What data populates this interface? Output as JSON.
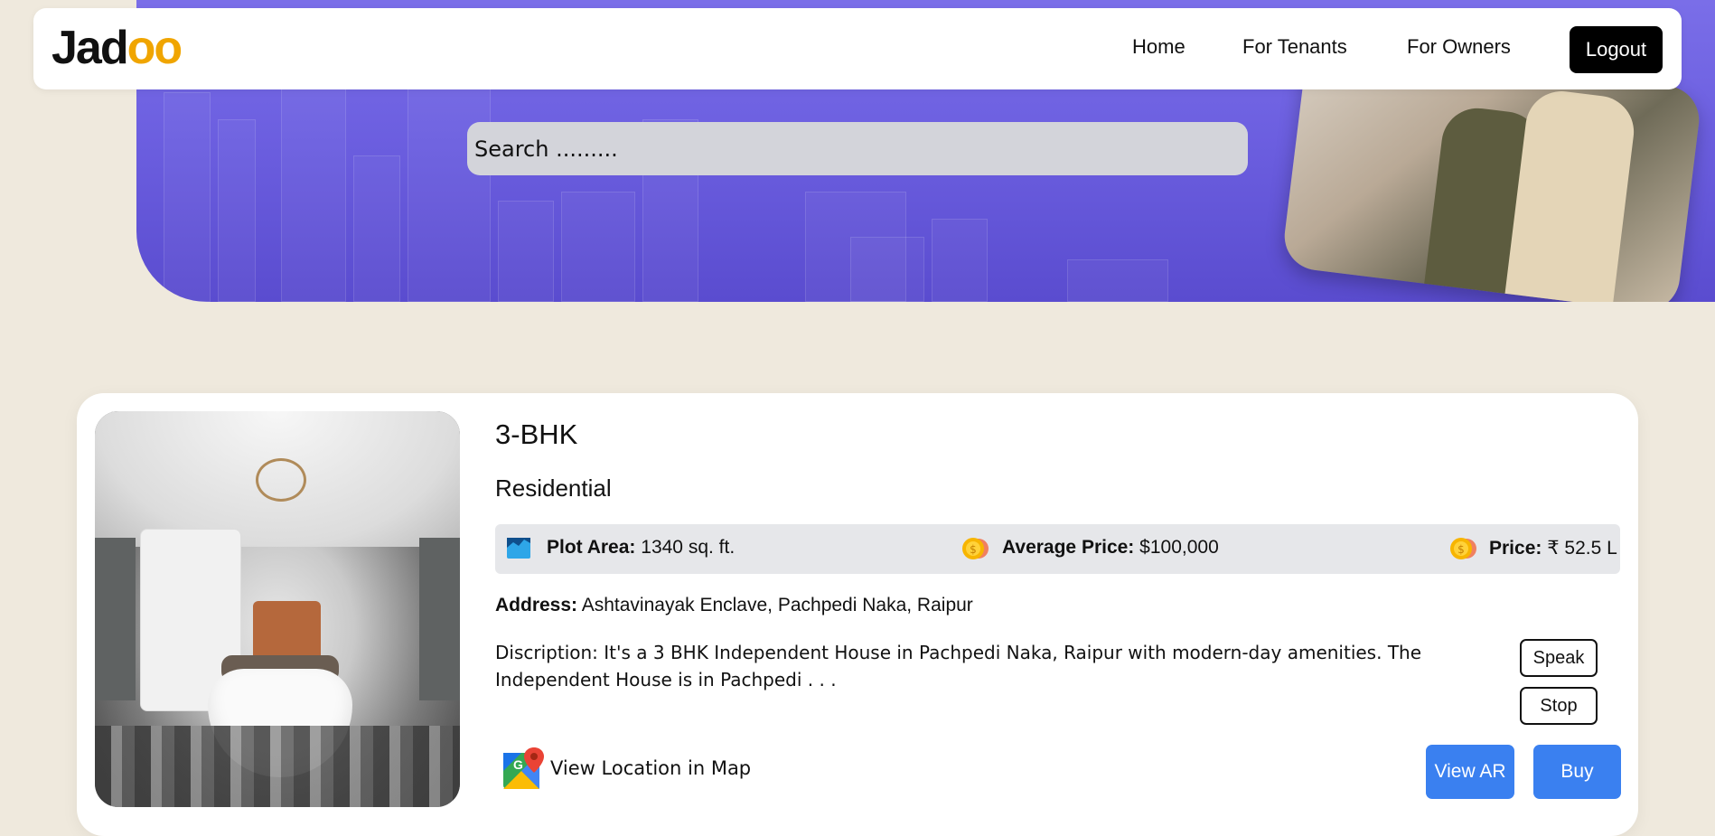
{
  "nav": {
    "logo_prefix": "Jad",
    "logo_suffix": "oo",
    "links": [
      "Home",
      "For Tenants",
      "For Owners"
    ],
    "logout_label": "Logout"
  },
  "search": {
    "placeholder": "Search ........."
  },
  "listing": {
    "title": "3-BHK",
    "category": "Residential",
    "plot_area_label": "Plot Area:",
    "plot_area_value": "1340 sq. ft.",
    "avg_price_label": "Average Price:",
    "avg_price_value": "$100,000",
    "price_label": "Price:",
    "price_value": "₹ 52.5 L",
    "address_label": "Address:",
    "address_value": "Ashtavinayak Enclave, Pachpedi Naka, Raipur",
    "description": "Discription: It's a 3 BHK Independent House in Pachpedi Naka, Raipur with modern-day amenities. The Independent House is in Pachpedi . . .",
    "speak_label": "Speak",
    "stop_label": "Stop",
    "map_link_label": "View Location in Map",
    "view_ar_label": "View AR",
    "buy_label": "Buy"
  },
  "colors": {
    "hero": "#6c5fe0",
    "accent_blue": "#3a80f0",
    "logo_dots": "#f0a500",
    "page_bg": "#efe9dd"
  },
  "icons": [
    "plot-area-icon",
    "coin-icon",
    "google-maps-icon"
  ]
}
